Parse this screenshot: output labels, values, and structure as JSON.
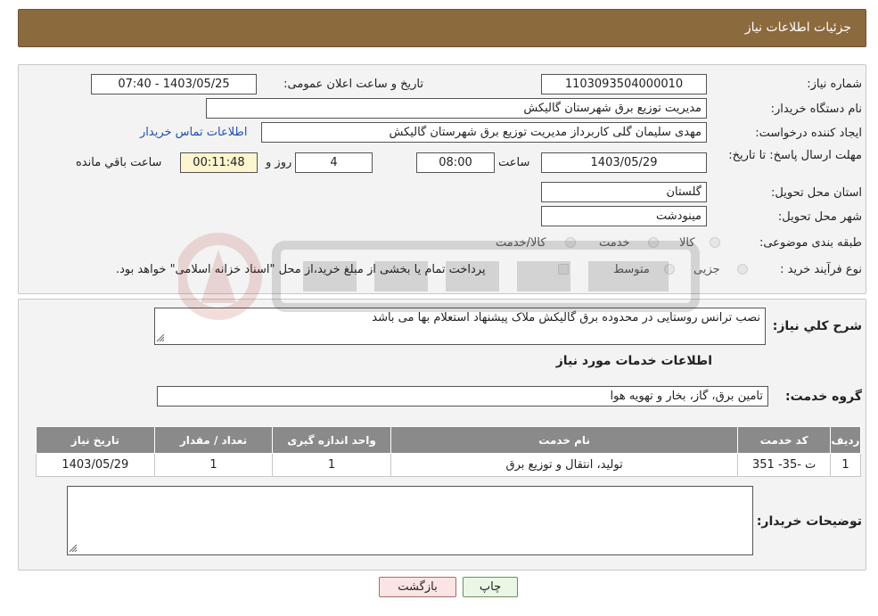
{
  "header": {
    "title": "جزئیات اطلاعات نیاز"
  },
  "form": {
    "need_number": {
      "label": "شماره نیاز:",
      "value": "1103093504000010"
    },
    "announce_datetime": {
      "label": "تاریخ و ساعت اعلان عمومی:",
      "value": "1403/05/25 - 07:40"
    },
    "buyer_org": {
      "label": "نام دستگاه خریدار:",
      "value": "مدیریت توزیع برق شهرستان گالیکش"
    },
    "creator": {
      "label": "ایجاد کننده درخواست:",
      "value": "مهدی سلیمان گلی کاربرداز مدیریت توزیع برق شهرستان گالیکش",
      "contact_link": "اطلاعات تماس خریدار"
    },
    "deadline": {
      "label": "مهلت ارسال پاسخ: تا تاریخ:",
      "date": "1403/05/29",
      "time_label": "ساعت",
      "time": "08:00",
      "days": "4",
      "days_label": "روز و",
      "remaining": "00:11:48",
      "remaining_label": "ساعت باقي مانده"
    },
    "province": {
      "label": "استان محل تحویل:",
      "value": "گلستان"
    },
    "city": {
      "label": "شهر محل تحویل:",
      "value": "مینودشت"
    },
    "category": {
      "label": "طبقه بندی موضوعی:",
      "options": [
        "کالا",
        "خدمت",
        "کالا/خدمت"
      ]
    },
    "process": {
      "label": "نوع فرآیند خرید :",
      "options": [
        "جزیی",
        "متوسط"
      ],
      "note": "پرداخت تمام یا بخشی از مبلغ خرید،از محل \"اسناد خزانه اسلامی\" خواهد بود."
    }
  },
  "summary": {
    "label": "شرح کلي نياز:",
    "value": "نصب ترانس روستایی در محدوده برق گالیکش ملاک پیشنهاد استعلام بها می باشد"
  },
  "services": {
    "section_title": "اطلاعات خدمات مورد نیاز",
    "group_label": "گروه خدمت:",
    "group_value": "تامین برق، گاز، بخار و تهویه هوا",
    "columns": [
      "ردیف",
      "کد خدمت",
      "نام خدمت",
      "واحد اندازه گیری",
      "تعداد / مقدار",
      "تاریخ نیاز"
    ],
    "rows": [
      {
        "row": "1",
        "code": "ت -35- 351",
        "name": "تولید، انتقال و توزیع برق",
        "unit": "1",
        "qty": "1",
        "date": "1403/05/29"
      }
    ]
  },
  "buyer_notes": {
    "label": "توضیحات خریدار:",
    "value": ""
  },
  "buttons": {
    "print": "چاپ",
    "back": "بازگشت"
  },
  "colors": {
    "header_bg": "#8b6a3e",
    "table_header_bg": "#8a8a8a",
    "timer_bg": "#fdf5cf",
    "link": "#1f4fb3"
  }
}
